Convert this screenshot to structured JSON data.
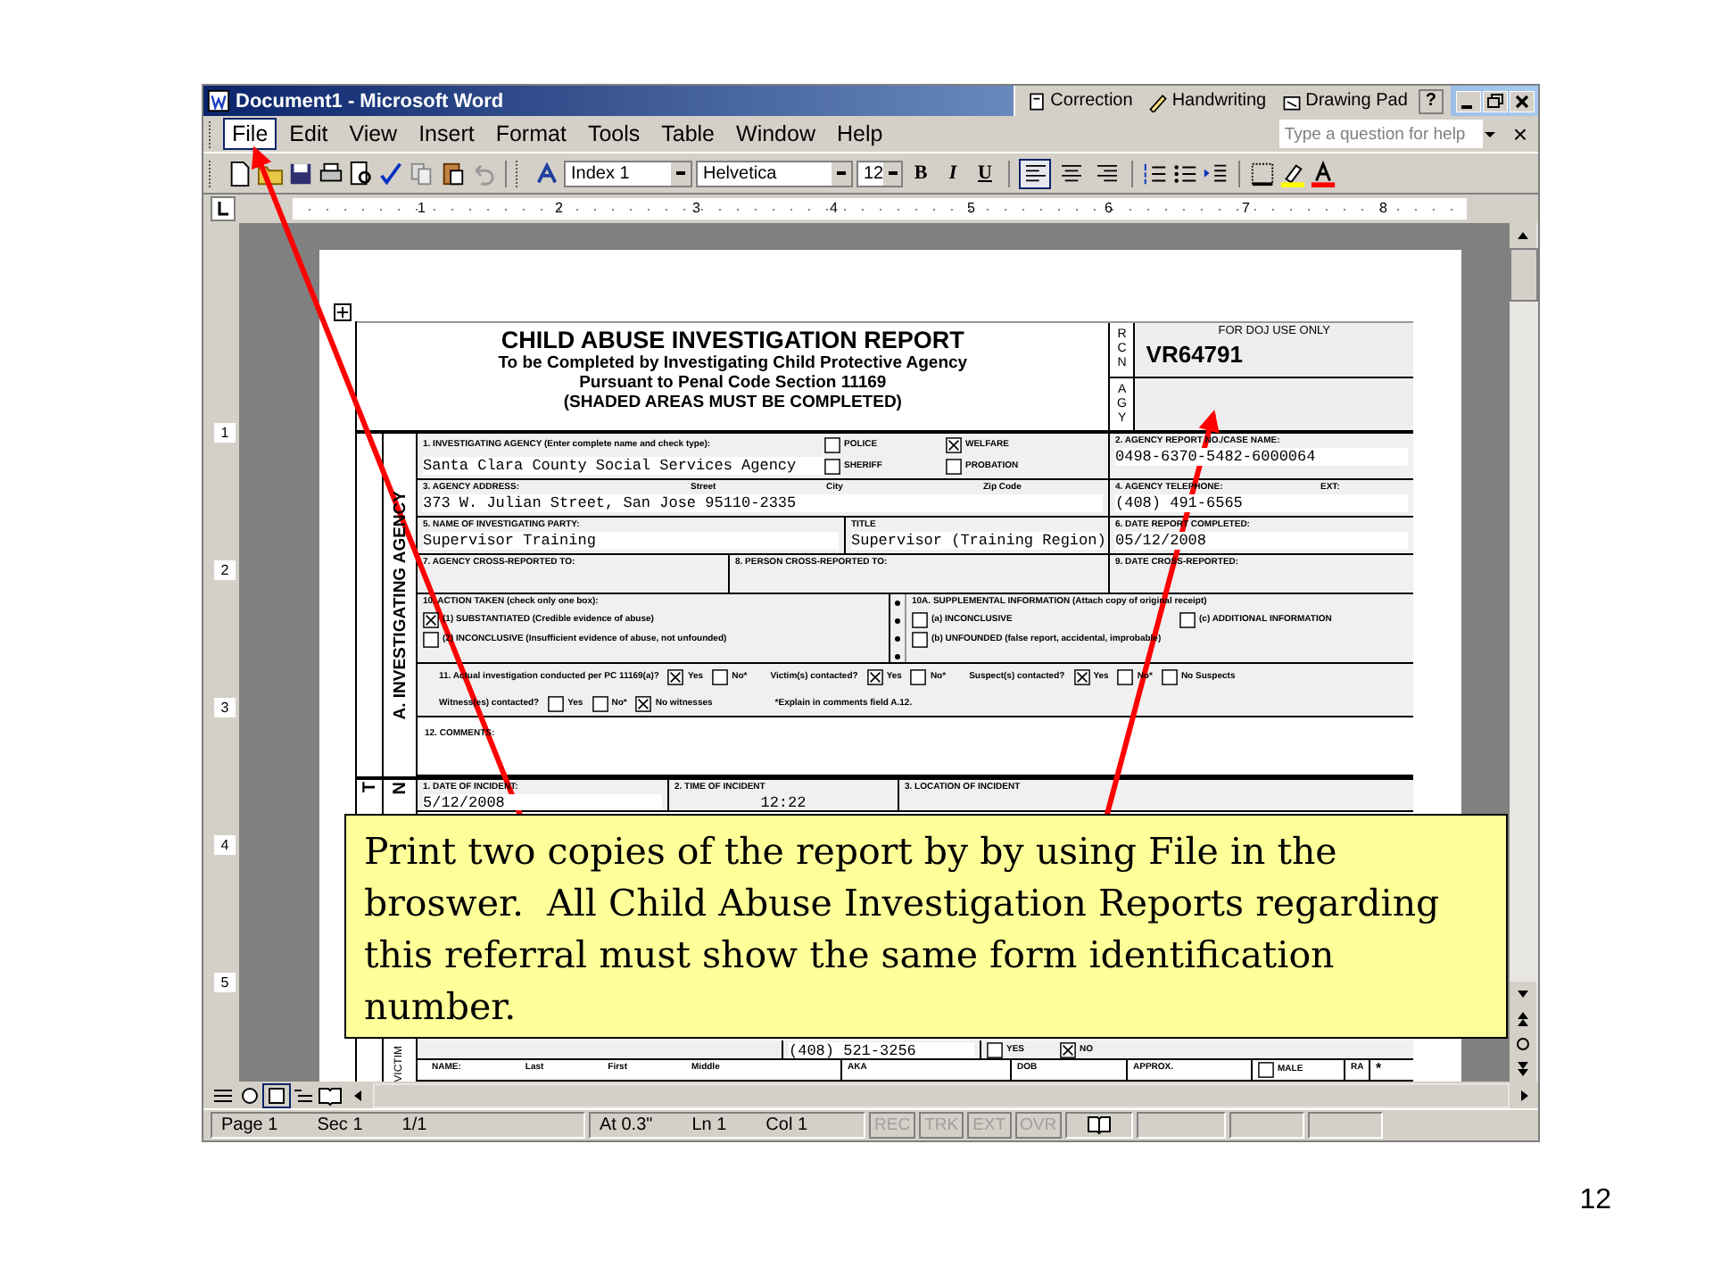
{
  "window": {
    "title": "Document1 - Microsoft Word"
  },
  "ink_toolbar": [
    "Correction",
    "Handwriting",
    "Drawing Pad"
  ],
  "help_button": "?",
  "menu": [
    {
      "label": "File",
      "selected": true
    },
    {
      "label": "Edit",
      "selected": false
    },
    {
      "label": "View",
      "selected": false
    },
    {
      "label": "Insert",
      "selected": false
    },
    {
      "label": "Format",
      "selected": false
    },
    {
      "label": "Tools",
      "selected": false
    },
    {
      "label": "Table",
      "selected": false
    },
    {
      "label": "Window",
      "selected": false
    },
    {
      "label": "Help",
      "selected": false
    }
  ],
  "help_field": {
    "placeholder": "Type a question for help"
  },
  "menu_close": "×",
  "format_toolbar": {
    "style": "Index 1",
    "font": "Helvetica",
    "size": "12",
    "text_buttons": [
      "B",
      "I",
      "U"
    ],
    "align_buttons": [
      {
        "kind": "left",
        "selected": true
      },
      {
        "kind": "center",
        "selected": false
      },
      {
        "kind": "right",
        "selected": false
      }
    ]
  },
  "ruler_numbers": [
    "1",
    "2",
    "3",
    "4",
    "5",
    "6",
    "7",
    "8"
  ],
  "vertical_ruler_numbers": [
    "1",
    "2",
    "3",
    "4",
    "5"
  ],
  "form": {
    "title": "CHILD ABUSE INVESTIGATION REPORT",
    "subtitle_lines": [
      "To be Completed by Investigating Child Protective Agency",
      "Pursuant to Penal Code Section 11169",
      "(SHADED AREAS MUST BE COMPLETED)"
    ],
    "rcn_letters": [
      "R",
      "C",
      "N"
    ],
    "agy_letters": [
      "A",
      "G",
      "Y"
    ],
    "doj_label": "FOR DOJ USE ONLY",
    "rcn": "VR64791",
    "section_a": "A. INVESTIGATING AGENCY",
    "agency": {
      "label": "1. INVESTIGATING AGENCY (Enter complete name and check type):",
      "value": "Santa Clara County Social Services Agency",
      "types": [
        {
          "label": "POLICE",
          "checked": false
        },
        {
          "label": "WELFARE",
          "checked": true
        },
        {
          "label": "SHERIFF",
          "checked": false
        },
        {
          "label": "PROBATION",
          "checked": false
        }
      ]
    },
    "report_no": {
      "label": "2. AGENCY REPORT NO./CASE NAME:",
      "value": "0498-6370-5482-6000064"
    },
    "address": {
      "label": "3. AGENCY ADDRESS:",
      "parts": [
        "Street",
        "City",
        "Zip Code"
      ],
      "value": "373 W. Julian Street, San Jose 95110-2335"
    },
    "telephone": {
      "label": "4. AGENCY TELEPHONE:",
      "ext_label": "EXT:",
      "value": "(408) 491-6565"
    },
    "party": {
      "label": "5. NAME OF INVESTIGATING PARTY:",
      "value": "Supervisor Training"
    },
    "title_field": {
      "label": "TITLE",
      "value": "Supervisor (Training Region)"
    },
    "date_completed": {
      "label": "6. DATE REPORT COMPLETED:",
      "value": "05/12/2008"
    },
    "cross_labels": [
      "7. AGENCY CROSS-REPORTED TO:",
      "8. PERSON CROSS-REPORTED TO:",
      "9. DATE CROSS-REPORTED:"
    ],
    "action": {
      "label": "10. ACTION TAKEN (check only one box):",
      "options": [
        {
          "label": "(1) SUBSTANTIATED (Credible evidence of abuse)",
          "checked": true
        },
        {
          "label": "(2) INCONCLUSIVE (Insufficient evidence of abuse, not unfounded)",
          "checked": false
        }
      ]
    },
    "supplemental": {
      "label": "10A. SUPPLEMENTAL INFORMATION (Attach copy of original receipt)",
      "options": [
        {
          "label": "(a) INCONCLUSIVE",
          "checked": false
        },
        {
          "label": "(c) ADDITIONAL INFORMATION",
          "checked": false
        },
        {
          "label": "(b) UNFOUNDED (false report, accidental, improbable)",
          "checked": false
        }
      ]
    },
    "contacts": [
      {
        "question": "11. Actual investigation conducted per PC 11169(a)?",
        "options": [
          {
            "label": "Yes",
            "checked": true
          },
          {
            "label": "No*",
            "checked": false
          }
        ]
      },
      {
        "question": "Victim(s) contacted?",
        "options": [
          {
            "label": "Yes",
            "checked": true
          },
          {
            "label": "No*",
            "checked": false
          }
        ]
      },
      {
        "question": "Suspect(s) contacted?",
        "options": [
          {
            "label": "Yes",
            "checked": true
          },
          {
            "label": "No*",
            "checked": false
          },
          {
            "label": "No Suspects",
            "checked": false
          }
        ]
      }
    ],
    "witness": {
      "question": "Witness(es) contacted?",
      "options": [
        {
          "label": "Yes",
          "checked": false
        },
        {
          "label": "No*",
          "checked": false
        },
        {
          "label": "No witnesses",
          "checked": true
        }
      ]
    },
    "note": "*Explain in comments field A.12.",
    "comments_label": "12. COMMENTS:",
    "section_b_gutter": "T",
    "section_b_label": "N",
    "incident": [
      {
        "label": "1. DATE OF INCIDENT:",
        "value": "5/12/2008"
      },
      {
        "label": "2. TIME OF INCIDENT",
        "value": "12:22"
      },
      {
        "label": "3. LOCATION OF INCIDENT"
      }
    ],
    "victim_label": "VICTIM",
    "victim_phone": "(408) 521-3256",
    "victim_flags": [
      {
        "label": "YES",
        "checked": false
      },
      {
        "label": "NO",
        "checked": true
      }
    ],
    "name_row": {
      "label": "NAME:",
      "parts": [
        "Last",
        "First",
        "Middle"
      ],
      "aka": "AKA",
      "dob": "DOB",
      "approx": "APPROX.",
      "male": {
        "label": "MALE",
        "checked": false
      },
      "race": "RA",
      "star": "*"
    }
  },
  "callout": "Print two copies of the report by by using File in the broswer.  All Child Abuse Investigation Reports regarding this referral must show the same form identification number.",
  "status_bar": {
    "position": [
      "Page 1",
      "Sec 1",
      "1/1"
    ],
    "cursor": [
      "At 0.3\"",
      "Ln 1",
      "Col 1"
    ],
    "modes": [
      {
        "label": "REC",
        "disabled": true
      },
      {
        "label": "TRK",
        "disabled": true
      },
      {
        "label": "EXT",
        "disabled": true
      },
      {
        "label": "OVR",
        "disabled": true
      }
    ]
  },
  "slide_number": "12"
}
